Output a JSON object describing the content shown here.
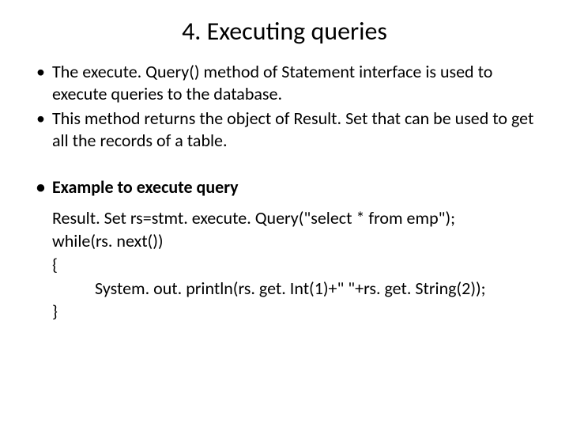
{
  "title": "4. Executing queries",
  "bullets": {
    "b1": "The execute. Query() method of Statement interface is used to execute queries to the database.",
    "b2": "This method returns the object of Result. Set that can be used to get all the records of a table.",
    "b3": "Example to execute query"
  },
  "code": {
    "l1": "Result. Set rs=stmt. execute. Query(\"select * from emp\");",
    "l2": "while(rs. next())",
    "l3": "{",
    "l4": "System. out. println(rs. get. Int(1)+\" \"+rs. get. String(2));",
    "l5": "}"
  }
}
